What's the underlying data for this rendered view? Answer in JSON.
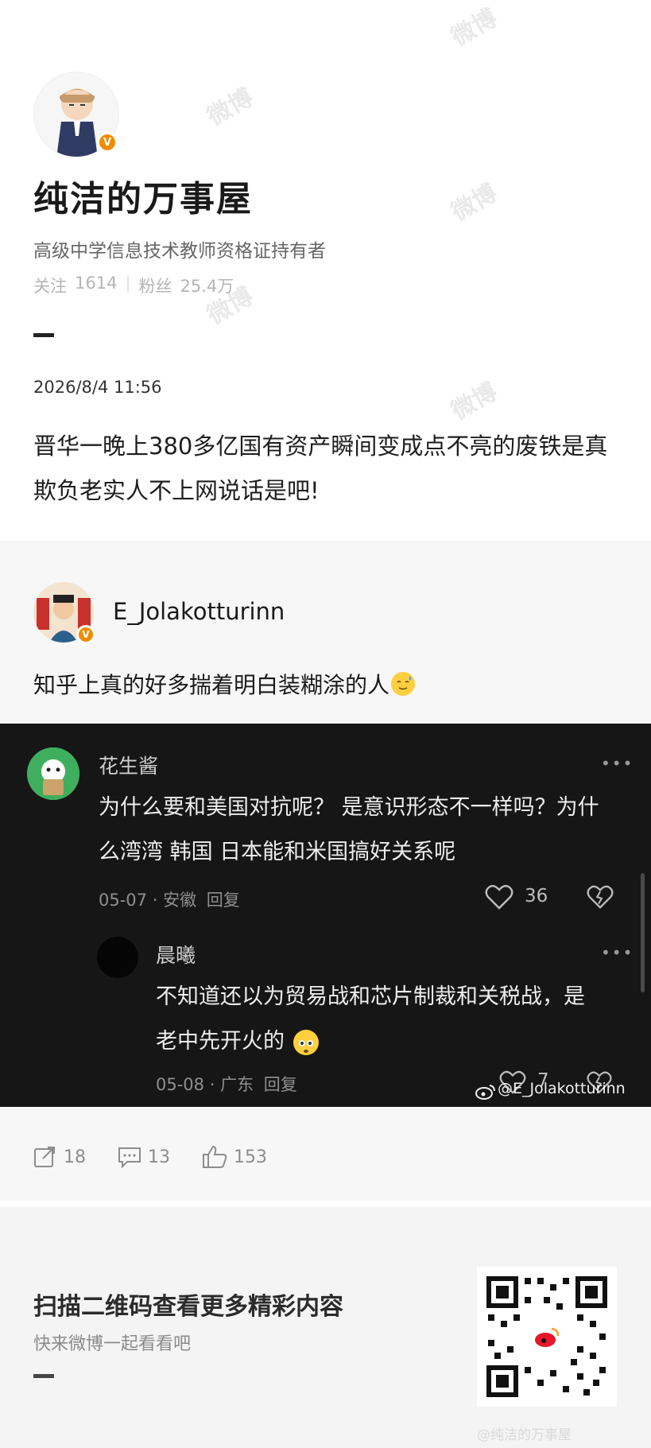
{
  "profile": {
    "name": "纯洁的万事屋",
    "description": "高级中学信息技术教师资格证持有者",
    "follow_label": "关注",
    "follow_count": "1614",
    "fans_label": "粉丝",
    "fans_count": "25.4万"
  },
  "post": {
    "time": "2026/8/4 11:56",
    "text": "晋华一晚上380多亿国有资产瞬间变成点不亮的废铁是真欺负老实人不上网说话是吧!"
  },
  "repost": {
    "user": "E_Jolakotturinn",
    "text": "知乎上真的好多揣着明白装糊涂的人"
  },
  "comments": [
    {
      "user": "花生酱",
      "text": "为什么要和美国对抗呢？ 是意识形态不一样吗？为什么湾湾 韩国 日本能和米国搞好关系呢",
      "date": "05-07",
      "region": "安徽",
      "reply_label": "回复",
      "likes": "36"
    },
    {
      "user": "晨曦",
      "text": "不知道还以为贸易战和芯片制裁和关税战，是老中先开火的",
      "date": "05-08",
      "region": "广东",
      "reply_label": "回复",
      "likes": "7"
    }
  ],
  "screenshot_credit": "@E_Jolakotturinn",
  "actions": {
    "repost_count": "18",
    "comment_count": "13",
    "like_count": "153"
  },
  "footer": {
    "scan_title": "扫描二维码查看更多精彩内容",
    "scan_sub": "快来微博一起看看吧",
    "bottom_watermark": "@纯洁的万事屋"
  },
  "watermark": "微博",
  "colors": {
    "verified": "#f08c00",
    "dark_bg": "#161616",
    "band_bg": "#f7f7f7"
  }
}
